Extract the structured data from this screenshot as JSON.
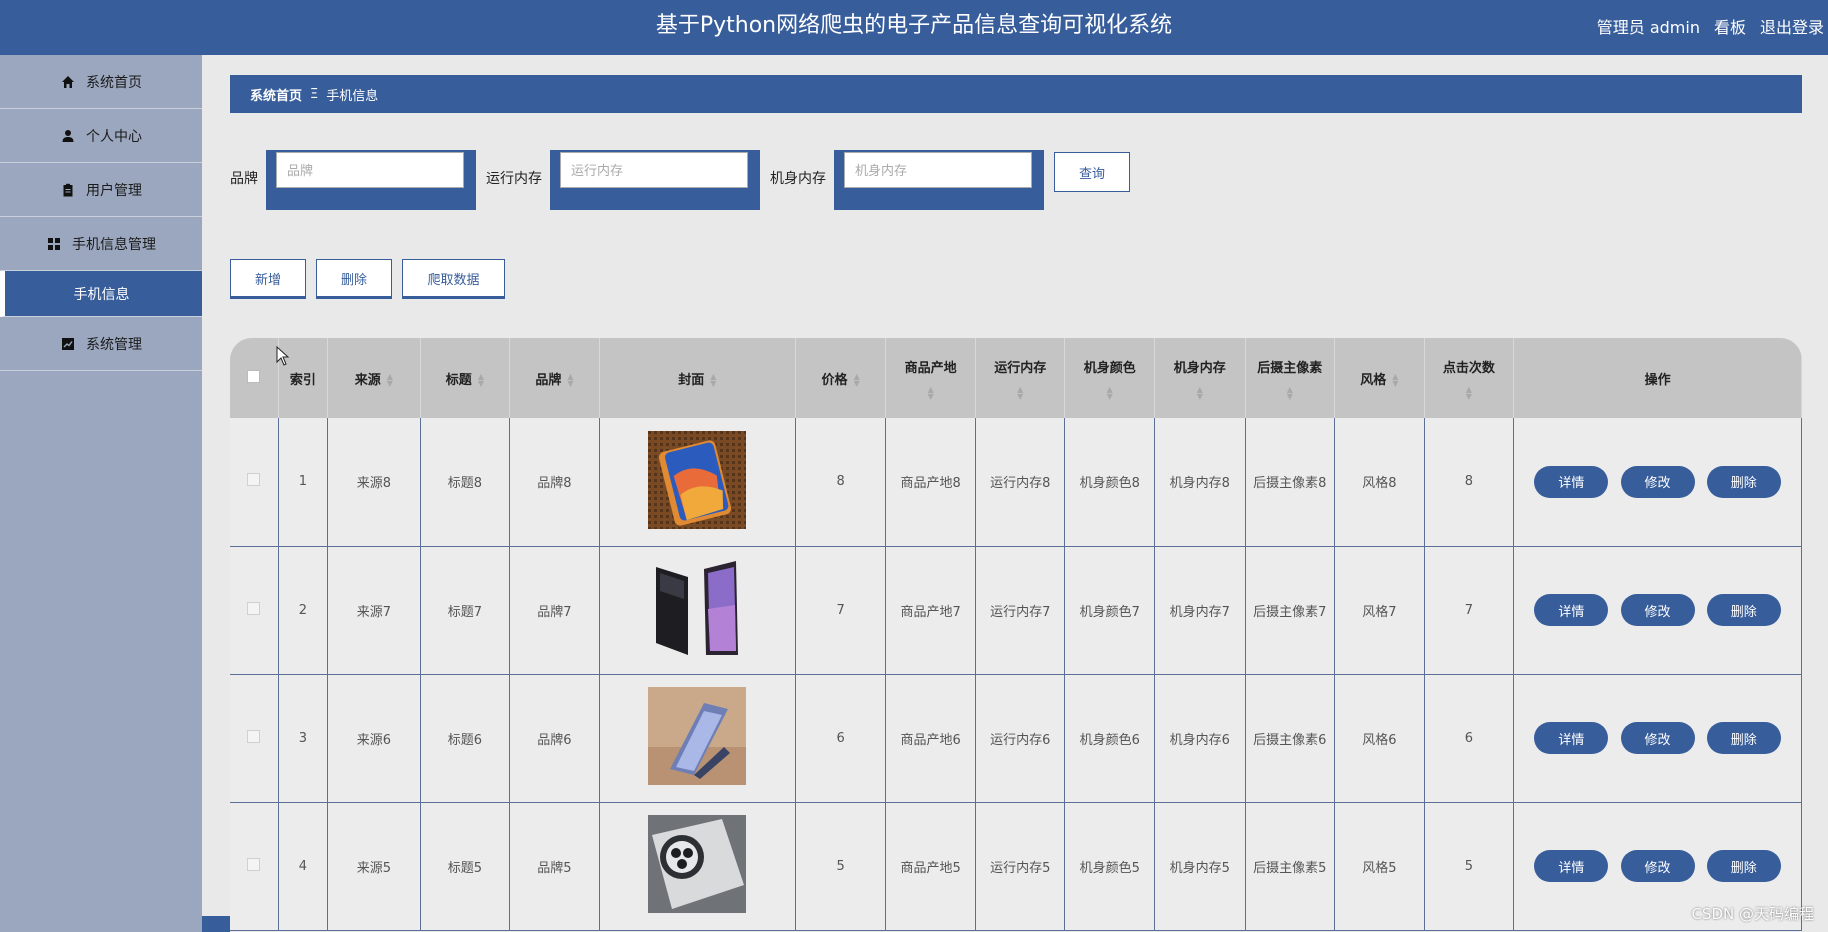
{
  "header": {
    "title": "基于Python网络爬虫的电子产品信息查询可视化系统",
    "user_label": "管理员 admin",
    "dashboard_label": "看板",
    "logout_label": "退出登录"
  },
  "sidebar": {
    "items": [
      {
        "label": "系统首页",
        "icon": "home-icon"
      },
      {
        "label": "个人中心",
        "icon": "user-icon"
      },
      {
        "label": "用户管理",
        "icon": "clipboard-icon"
      },
      {
        "label": "手机信息管理",
        "icon": "grid-icon"
      },
      {
        "label": "手机信息",
        "icon": ""
      },
      {
        "label": "系统管理",
        "icon": "chart-icon"
      }
    ]
  },
  "breadcrumb": {
    "home": "系统首页",
    "separator": "Ξ",
    "current": "手机信息"
  },
  "search": {
    "brand_label": "品牌",
    "brand_placeholder": "品牌",
    "ram_label": "运行内存",
    "ram_placeholder": "运行内存",
    "storage_label": "机身内存",
    "storage_placeholder": "机身内存",
    "query_button": "查询"
  },
  "actions": {
    "add": "新增",
    "delete": "删除",
    "crawl": "爬取数据"
  },
  "table": {
    "headers": {
      "index": "索引",
      "source": "来源",
      "title": "标题",
      "brand": "品牌",
      "cover": "封面",
      "price": "价格",
      "origin": "商品产地",
      "ram": "运行内存",
      "color": "机身颜色",
      "storage": "机身内存",
      "camera": "后摄主像素",
      "style": "风格",
      "clicks": "点击次数",
      "ops": "操作"
    },
    "op_labels": {
      "detail": "详情",
      "edit": "修改",
      "delete": "删除"
    },
    "rows": [
      {
        "index": "1",
        "source": "来源8",
        "title": "标题8",
        "brand": "品牌8",
        "cover": "orange-phone-image",
        "price": "8",
        "origin": "商品产地8",
        "ram": "运行内存8",
        "color": "机身颜色8",
        "storage": "机身内存8",
        "camera": "后摄主像素8",
        "style": "风格8",
        "clicks": "8"
      },
      {
        "index": "2",
        "source": "来源7",
        "title": "标题7",
        "brand": "品牌7",
        "cover": "foldable-phone-image",
        "price": "7",
        "origin": "商品产地7",
        "ram": "运行内存7",
        "color": "机身颜色7",
        "storage": "机身内存7",
        "camera": "后摄主像素7",
        "style": "风格7",
        "clicks": "7"
      },
      {
        "index": "3",
        "source": "来源6",
        "title": "标题6",
        "brand": "品牌6",
        "cover": "flip-phone-image",
        "price": "6",
        "origin": "商品产地6",
        "ram": "运行内存6",
        "color": "机身颜色6",
        "storage": "机身内存6",
        "camera": "后摄主像素6",
        "style": "风格6",
        "clicks": "6"
      },
      {
        "index": "4",
        "source": "来源5",
        "title": "标题5",
        "brand": "品牌5",
        "cover": "camera-phone-image",
        "price": "5",
        "origin": "商品产地5",
        "ram": "运行内存5",
        "color": "机身颜色5",
        "storage": "机身内存5",
        "camera": "后摄主像素5",
        "style": "风格5",
        "clicks": "5"
      }
    ]
  },
  "watermark": "CSDN @天码编程",
  "colors": {
    "primary": "#375d9b",
    "sidebar": "#9ba7bf",
    "background": "#e9e9e9",
    "table_header": "#c4c4c4"
  }
}
